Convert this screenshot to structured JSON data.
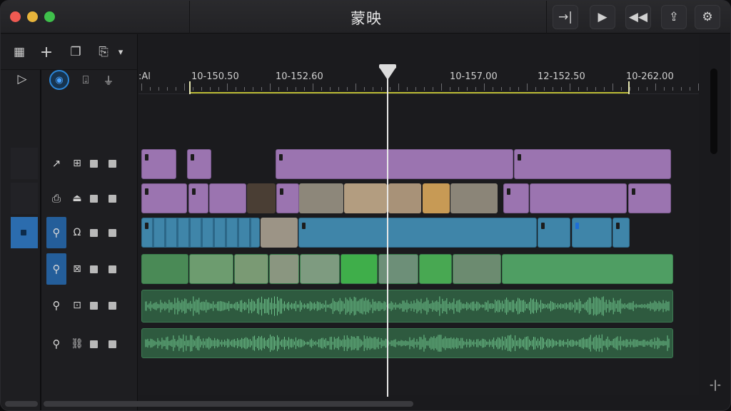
{
  "app": {
    "title": "蒙映"
  },
  "titlebar": {
    "buttons": [
      {
        "name": "split-to-right",
        "glyph": "→|"
      },
      {
        "name": "play",
        "glyph": "▶"
      },
      {
        "name": "rewind",
        "glyph": "◀◀"
      },
      {
        "name": "export",
        "glyph": "⇪"
      },
      {
        "name": "settings",
        "glyph": "⚙"
      }
    ]
  },
  "toolbar": {
    "tools": [
      {
        "name": "grid-icon",
        "glyph": "▦"
      },
      {
        "name": "add-icon",
        "glyph": "+"
      },
      {
        "name": "copy-icon",
        "glyph": "❐"
      },
      {
        "name": "export-icon",
        "glyph": "⎘"
      },
      {
        "name": "dropdown-icon",
        "glyph": "▾"
      }
    ]
  },
  "controls": {
    "play_glyph": "▷",
    "visibility_glyph": "◉",
    "marker_glyph": "⍗",
    "signal_glyph": "⏚"
  },
  "ruler": {
    "labels": [
      ":Al",
      "10-150.50",
      "10-152.60",
      "10-157.00",
      "12-152.50",
      "10-262.00"
    ]
  },
  "tracks": [
    {
      "type_glyph": "↗",
      "icon2_glyph": "⊞",
      "active_left": false,
      "active_type": false
    },
    {
      "type_glyph": "⎙",
      "icon2_glyph": "⏏",
      "active_left": false,
      "active_type": false
    },
    {
      "type_glyph": "⚲",
      "icon2_glyph": "Ω",
      "active_left": true,
      "active_type": true
    },
    {
      "type_glyph": "⚲",
      "icon2_glyph": "⊠",
      "active_left": false,
      "active_type": true
    },
    {
      "type_glyph": "⚲",
      "icon2_glyph": "⊡",
      "active_left": false,
      "active_type": false
    },
    {
      "type_glyph": "⚲",
      "icon2_glyph": "⛓",
      "active_left": false,
      "active_type": false
    }
  ],
  "colors": {
    "purple_clip": "#9b74b0",
    "blue_clip": "#3f85a9",
    "green_clip": "#4f9e63",
    "audio_clip": "#2e5a3f",
    "accent": "#2b86d8"
  },
  "zoom_glyph": "-|-"
}
